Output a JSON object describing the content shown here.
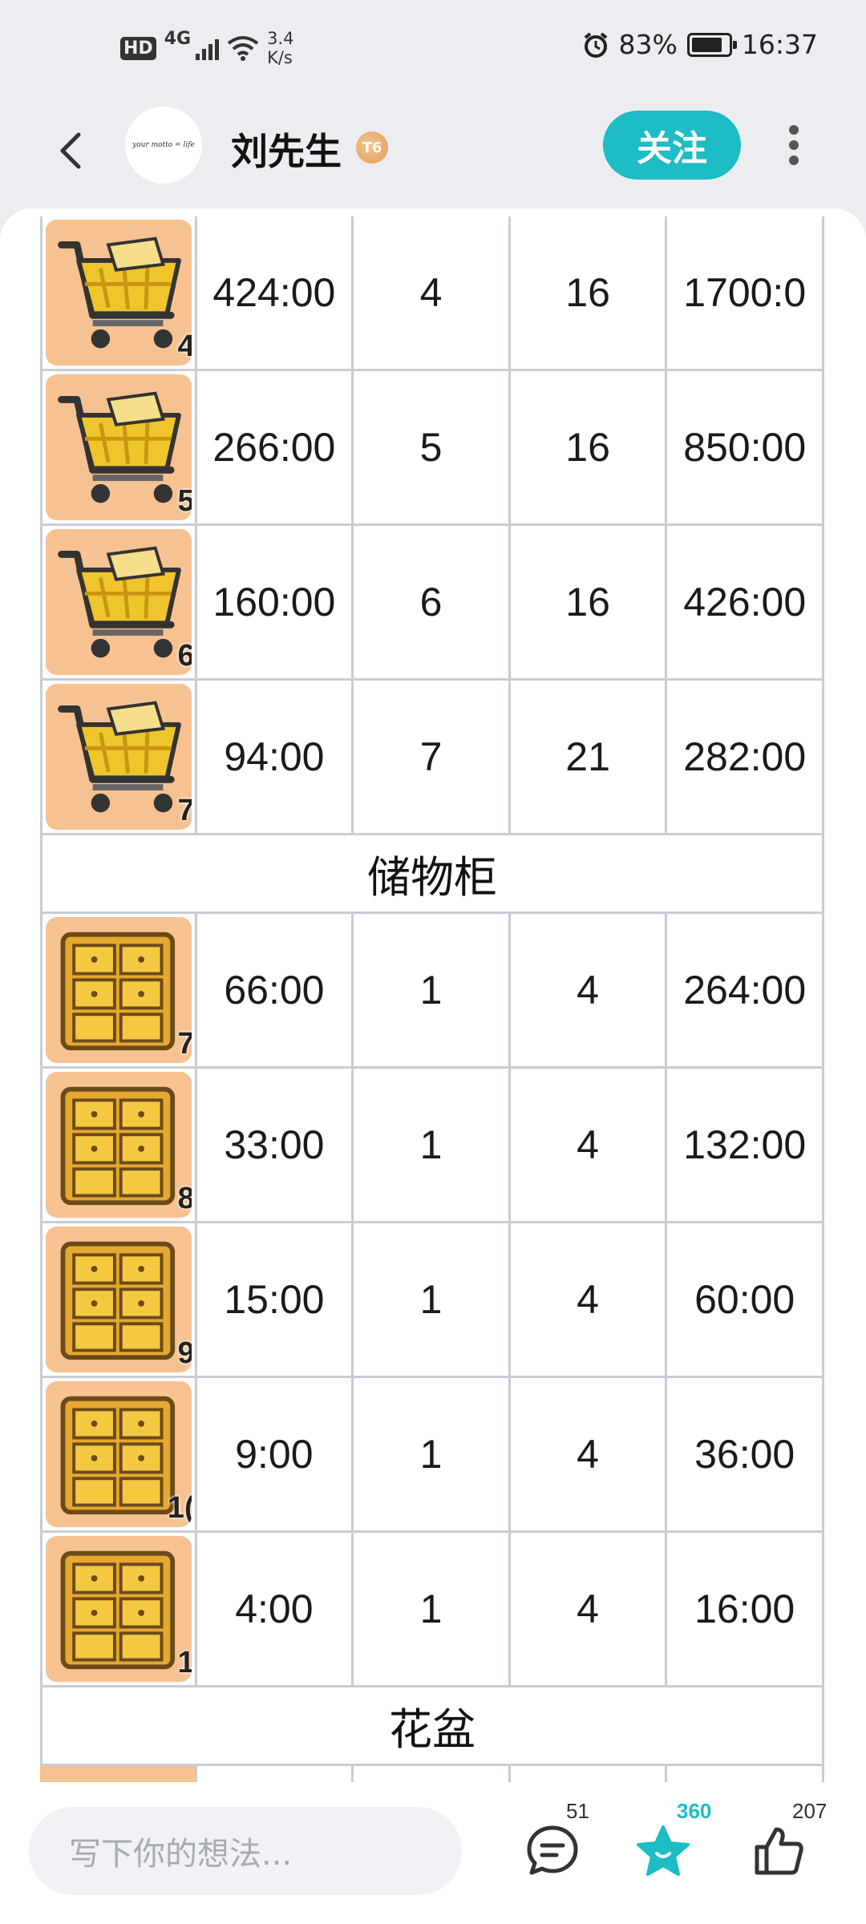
{
  "status_bar": {
    "hd": "HD",
    "network": "4G",
    "speed_value": "3.4",
    "speed_unit": "K/s",
    "battery_percent": "83%",
    "battery_level": 0.83,
    "time": "16:37",
    "icons": [
      "signal-icon",
      "wifi-icon",
      "alarm-icon",
      "battery-icon"
    ]
  },
  "header": {
    "username": "刘先生",
    "level_badge": "T6",
    "follow_label": "关注",
    "avatar_text": "your motto = life"
  },
  "table": {
    "section_headers": [
      "储物柜",
      "花盆"
    ],
    "cart_rows": [
      {
        "icon": "cart-icon",
        "level": "4",
        "time": "424:00",
        "a": "4",
        "b": "16",
        "total": "1700:0"
      },
      {
        "icon": "cart-icon",
        "level": "5",
        "time": "266:00",
        "a": "5",
        "b": "16",
        "total": "850:00"
      },
      {
        "icon": "cart-icon",
        "level": "6",
        "time": "160:00",
        "a": "6",
        "b": "16",
        "total": "426:00"
      },
      {
        "icon": "cart-icon",
        "level": "7",
        "time": "94:00",
        "a": "7",
        "b": "21",
        "total": "282:00"
      }
    ],
    "locker_rows": [
      {
        "icon": "locker-icon",
        "level": "7",
        "time": "66:00",
        "a": "1",
        "b": "4",
        "total": "264:00"
      },
      {
        "icon": "locker-icon",
        "level": "8",
        "time": "33:00",
        "a": "1",
        "b": "4",
        "total": "132:00"
      },
      {
        "icon": "locker-icon",
        "level": "9",
        "time": "15:00",
        "a": "1",
        "b": "4",
        "total": "60:00"
      },
      {
        "icon": "locker-icon",
        "level": "1(",
        "time": "9:00",
        "a": "1",
        "b": "4",
        "total": "36:00"
      },
      {
        "icon": "locker-icon",
        "level": "1",
        "time": "4:00",
        "a": "1",
        "b": "4",
        "total": "16:00"
      }
    ]
  },
  "bottom_bar": {
    "comment_placeholder": "写下你的想法...",
    "comment_count": "51",
    "star_count": "360",
    "like_count": "207"
  },
  "colors": {
    "accent": "#1ebcc4",
    "icon_bg": "#f7c291",
    "grid": "#c9ccd4"
  }
}
